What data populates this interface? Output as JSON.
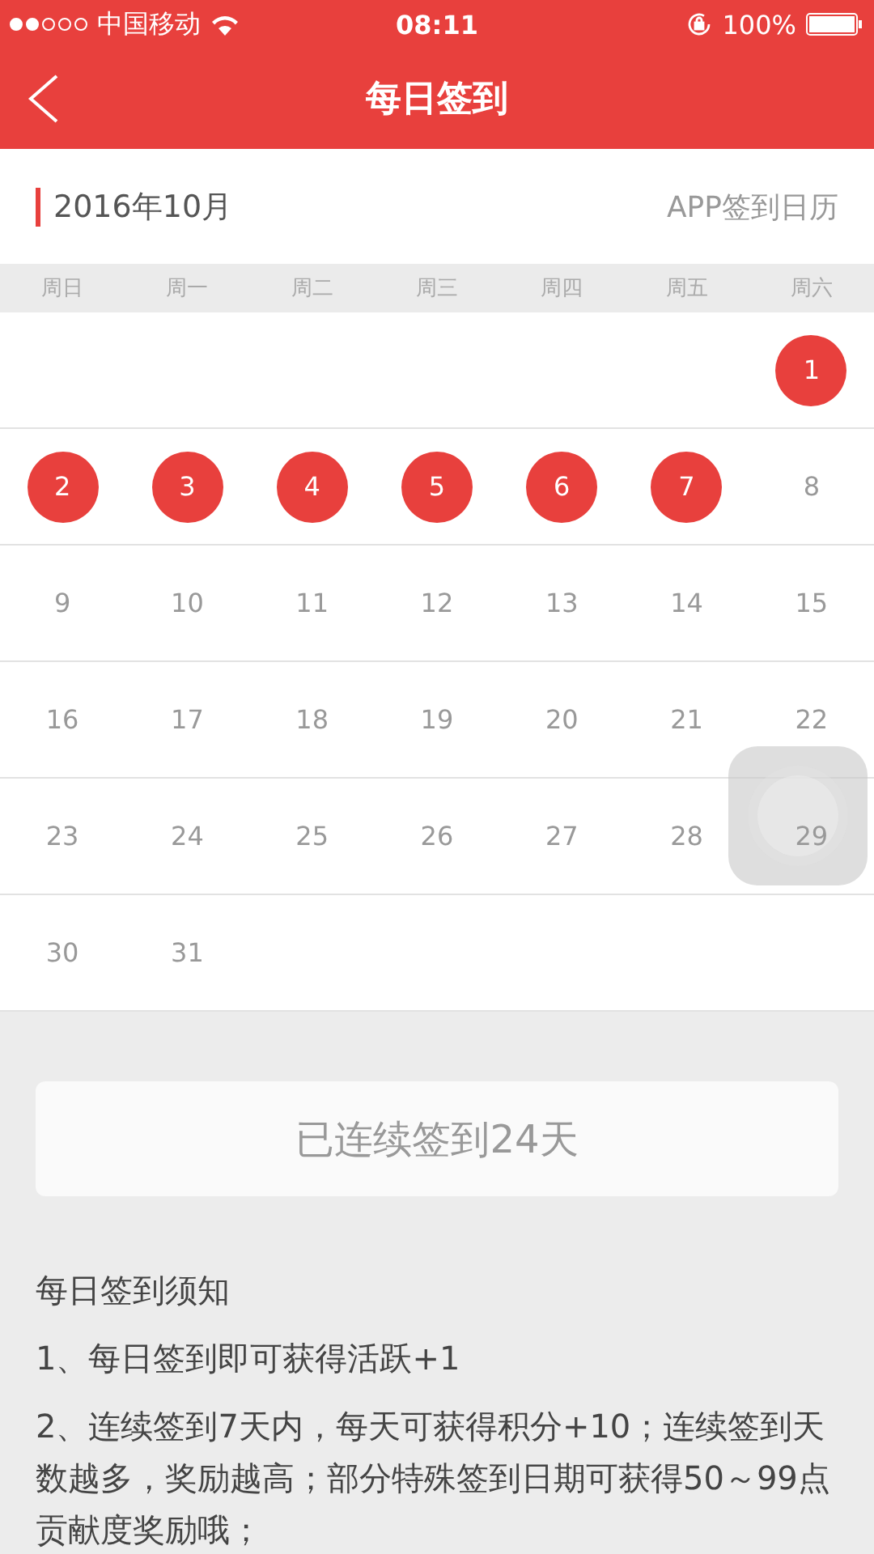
{
  "status_bar": {
    "carrier": "中国移动",
    "time": "08:11",
    "battery": "100%"
  },
  "nav": {
    "title": "每日签到"
  },
  "month": {
    "label": "2016年10月",
    "link": "APP签到日历"
  },
  "weekdays": [
    "周日",
    "周一",
    "周二",
    "周三",
    "周四",
    "周五",
    "周六"
  ],
  "weeks": [
    [
      {
        "kind": "blank"
      },
      {
        "kind": "blank"
      },
      {
        "kind": "blank"
      },
      {
        "kind": "blank"
      },
      {
        "kind": "blank"
      },
      {
        "kind": "blank"
      },
      {
        "kind": "day",
        "day": "1",
        "checked": true
      }
    ],
    [
      {
        "kind": "day",
        "day": "2",
        "checked": true
      },
      {
        "kind": "day",
        "day": "3",
        "checked": true
      },
      {
        "kind": "day",
        "day": "4",
        "checked": true
      },
      {
        "kind": "day",
        "day": "5",
        "checked": true
      },
      {
        "kind": "day",
        "day": "6",
        "checked": true
      },
      {
        "kind": "day",
        "day": "7",
        "checked": true
      },
      {
        "kind": "day",
        "day": "8",
        "checked": false
      }
    ],
    [
      {
        "kind": "day",
        "day": "9",
        "checked": false
      },
      {
        "kind": "day",
        "day": "10",
        "checked": false
      },
      {
        "kind": "day",
        "day": "11",
        "checked": false
      },
      {
        "kind": "day",
        "day": "12",
        "checked": false
      },
      {
        "kind": "day",
        "day": "13",
        "checked": false
      },
      {
        "kind": "day",
        "day": "14",
        "checked": false
      },
      {
        "kind": "day",
        "day": "15",
        "checked": false
      }
    ],
    [
      {
        "kind": "day",
        "day": "16",
        "checked": false
      },
      {
        "kind": "day",
        "day": "17",
        "checked": false
      },
      {
        "kind": "day",
        "day": "18",
        "checked": false
      },
      {
        "kind": "day",
        "day": "19",
        "checked": false
      },
      {
        "kind": "day",
        "day": "20",
        "checked": false
      },
      {
        "kind": "day",
        "day": "21",
        "checked": false
      },
      {
        "kind": "day",
        "day": "22",
        "checked": false
      }
    ],
    [
      {
        "kind": "day",
        "day": "23",
        "checked": false
      },
      {
        "kind": "day",
        "day": "24",
        "checked": false
      },
      {
        "kind": "day",
        "day": "25",
        "checked": false
      },
      {
        "kind": "day",
        "day": "26",
        "checked": false
      },
      {
        "kind": "day",
        "day": "27",
        "checked": false
      },
      {
        "kind": "day",
        "day": "28",
        "checked": false
      },
      {
        "kind": "day",
        "day": "29",
        "checked": false
      }
    ],
    [
      {
        "kind": "day",
        "day": "30",
        "checked": false
      },
      {
        "kind": "day",
        "day": "31",
        "checked": false
      },
      {
        "kind": "blank"
      },
      {
        "kind": "blank"
      },
      {
        "kind": "blank"
      },
      {
        "kind": "blank"
      },
      {
        "kind": "blank"
      }
    ]
  ],
  "summary": "已连续签到24天",
  "notice": {
    "title": "每日签到须知",
    "items": [
      "1、每日签到即可获得活跃+1",
      "2、连续签到7天内，每天可获得积分+10；连续签到天数越多，奖励越高；部分特殊签到日期可获得50～99点贡献度奖励哦；"
    ]
  }
}
